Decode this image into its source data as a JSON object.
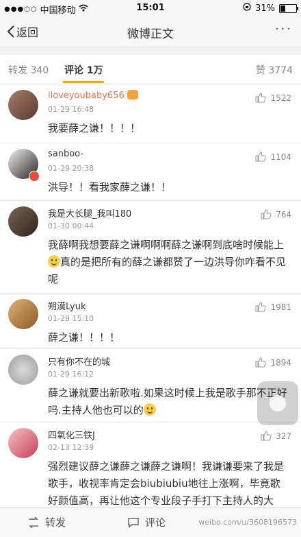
{
  "status": {
    "carrier": "中国移动",
    "time": "15:01",
    "battery": "31%",
    "battery_level": 0.31
  },
  "nav": {
    "back_label": "返回",
    "title": "微博正文",
    "more": "···"
  },
  "tabs": [
    {
      "label": "转发 340"
    },
    {
      "label": "评论 1万"
    },
    {
      "label": "赞 3774"
    }
  ],
  "comments": [
    {
      "user": "iloveyoubaby656",
      "time": "01-29 16:48",
      "likes": "1522",
      "text": "我要薛之谦！！！！"
    },
    {
      "user": "sanboo-",
      "time": "01-29 20:38",
      "likes": "1104",
      "text": "洪导！！看我家薛之谦！！"
    },
    {
      "user": "我是大长腿_我叫180",
      "time": "01-30 00:44",
      "likes": "764",
      "text1": "我薛啊我想要薛之谦啊啊啊薛之谦啊到底啥时候能上",
      "text2": "真的是把所有的薛之谦都赞了一边洪导你咋看不见呢"
    },
    {
      "user": "朔漠Lyuk",
      "time": "01-29 15:10",
      "likes": "1981",
      "text": "薛之谦！！！！"
    },
    {
      "user": "只有你不在的城",
      "time": "01-29 16:12",
      "likes": "1894",
      "text": "薛之谦就要出新歌啦.如果这时候上我是歌手那不正好吗.主持人他也可以的"
    },
    {
      "user": "四氧化三铁J",
      "time": "02-13 12:39",
      "likes": "327",
      "text": "强烈建议薛之谦薛之谦薛之谦啊！我谦谦要来了我是歌手，收视率肯定会biubiubiu地往上涨啊，毕竟歌好颜值高，再让他这个专业段子手打下主持人的大旗，那绝对是收视爆点啊"
    }
  ],
  "bottom": {
    "repost": "转发",
    "comment": "评论",
    "watermark": "weibo.com/u/3608196573"
  }
}
